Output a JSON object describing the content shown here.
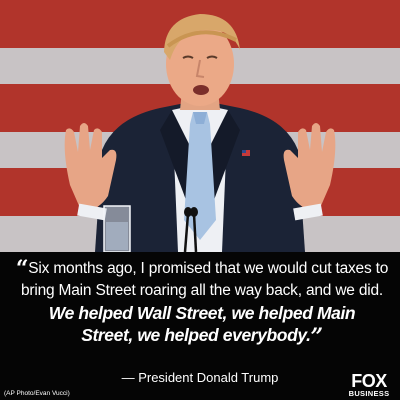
{
  "photo": {
    "subject": "man-speaking-at-podium",
    "background": "american-flag-stripes",
    "colors": {
      "flag_red": "#c1392f",
      "flag_white": "#d9d4d6",
      "suit": "#1b2336",
      "tie": "#a8c3e2"
    }
  },
  "quote": {
    "open_mark": "“",
    "line1": "Six months ago, I promised that we would cut taxes to",
    "line2": "bring Main Street roaring all the way back, and we did.",
    "line3": "We helped Wall Street, we helped Main",
    "line4": "Street, we helped everybody.",
    "close_mark": "”"
  },
  "attribution": "— President Donald Trump",
  "credit": "(AP Photo/Evan Vucci)",
  "logo": {
    "brand": "FOX",
    "sub": "BUSINESS",
    "icon": "fox-business-logo-icon"
  }
}
